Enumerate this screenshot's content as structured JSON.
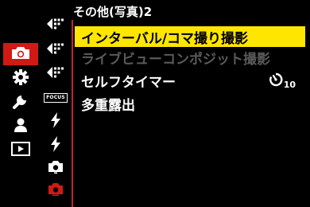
{
  "header": {
    "title": "その他(写真)2"
  },
  "main_menu": {
    "items": [
      {
        "icon": "camera-icon",
        "selected": true
      },
      {
        "icon": "gear-icon",
        "selected": false
      },
      {
        "icon": "wrench-icon",
        "selected": false
      },
      {
        "icon": "person-icon",
        "selected": false
      },
      {
        "icon": "playback-icon",
        "selected": false
      }
    ]
  },
  "sub_tabs": {
    "items": [
      {
        "icon": "image-quality-icon",
        "selected": false
      },
      {
        "icon": "image-quality-icon",
        "selected": false
      },
      {
        "icon": "image-quality-icon",
        "selected": false
      },
      {
        "icon": "focus-icon",
        "label": "FOCUS",
        "selected": false
      },
      {
        "icon": "flash-icon",
        "selected": false
      },
      {
        "icon": "flash-icon",
        "selected": false
      },
      {
        "icon": "camera-small-icon",
        "selected": false
      },
      {
        "icon": "camera-small-icon",
        "selected": true
      }
    ]
  },
  "menu": {
    "items": [
      {
        "label": "インターバル/コマ撮り撮影",
        "state": "highlighted"
      },
      {
        "label": "ライブビューコンポジット撮影",
        "state": "disabled"
      },
      {
        "label": "セルフタイマー",
        "state": "normal",
        "value_icon": "self-timer-icon",
        "value_text": "10"
      },
      {
        "label": "多重露出",
        "state": "normal"
      }
    ]
  },
  "colors": {
    "accent": "#d11a14",
    "highlight": "#ffe600",
    "divider": "#c0272d",
    "disabled_text": "#5a5a5a"
  }
}
